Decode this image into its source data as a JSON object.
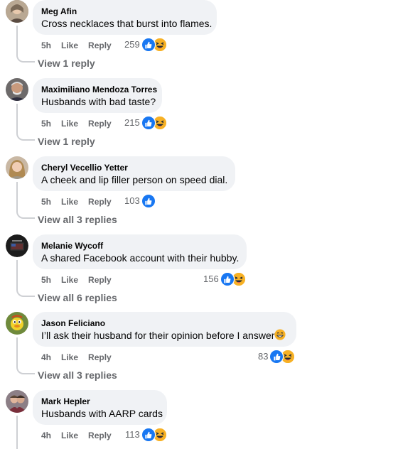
{
  "comments": [
    {
      "author": "Meg Afin",
      "text": "Cross necklaces that burst into flames.",
      "time": "5h",
      "like": "Like",
      "reply": "Reply",
      "count": "259",
      "reactions": [
        "like",
        "haha"
      ],
      "view_replies": "View 1 reply"
    },
    {
      "author": "Maximiliano Mendoza Torres",
      "text": "Husbands with bad taste?",
      "time": "5h",
      "like": "Like",
      "reply": "Reply",
      "count": "215",
      "reactions": [
        "like",
        "haha"
      ],
      "view_replies": "View 1 reply"
    },
    {
      "author": "Cheryl Vecellio Yetter",
      "text": "A cheek and lip filler person on speed dial.",
      "time": "5h",
      "like": "Like",
      "reply": "Reply",
      "count": "103",
      "reactions": [
        "like"
      ],
      "view_replies": "View all 3 replies"
    },
    {
      "author": "Melanie Wycoff",
      "text": "A shared Facebook account with their hubby.",
      "time": "5h",
      "like": "Like",
      "reply": "Reply",
      "count": "156",
      "reactions": [
        "like",
        "haha"
      ],
      "view_replies": "View all 6 replies"
    },
    {
      "author": "Jason Feliciano",
      "text": "I’ll ask their husband for their opinion before I answer",
      "time": "4h",
      "like": "Like",
      "reply": "Reply",
      "count": "83",
      "reactions": [
        "like",
        "haha"
      ],
      "view_replies": "View all 3 replies"
    },
    {
      "author": "Mark Hepler",
      "text": "Husbands with AARP cards",
      "time": "4h",
      "like": "Like",
      "reply": "Reply",
      "count": "113",
      "reactions": [
        "like",
        "haha"
      ]
    }
  ],
  "colors": {
    "bubble": "#f0f2f5",
    "secondary_text": "#65676b",
    "like_blue": "#1877f2",
    "haha_yellow": "#f7b125"
  }
}
